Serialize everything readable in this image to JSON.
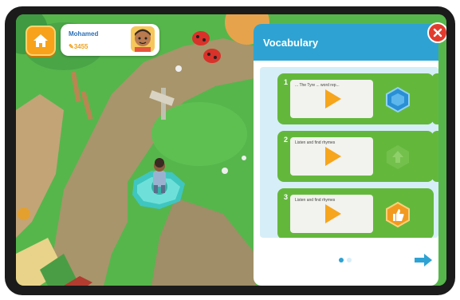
{
  "hud": {
    "player_name": "Mohamed",
    "player_score": "3455"
  },
  "panel": {
    "title": "Vocabulary",
    "cards": [
      {
        "number": "1",
        "caption": "... The Tyre ... word rep...",
        "badge": "hexagon-blue"
      },
      {
        "number": "2",
        "caption": "Listen and find rhymes",
        "badge": "arrow-up-locked"
      },
      {
        "number": "3",
        "caption": "Listen and find rhymes",
        "badge": "thumbs-up-orange"
      }
    ],
    "page_count": 2,
    "current_page": 1
  },
  "colors": {
    "accent": "#2ea3d3",
    "card": "#63b83c",
    "play": "#f6a51c",
    "close": "#e23b2e"
  }
}
